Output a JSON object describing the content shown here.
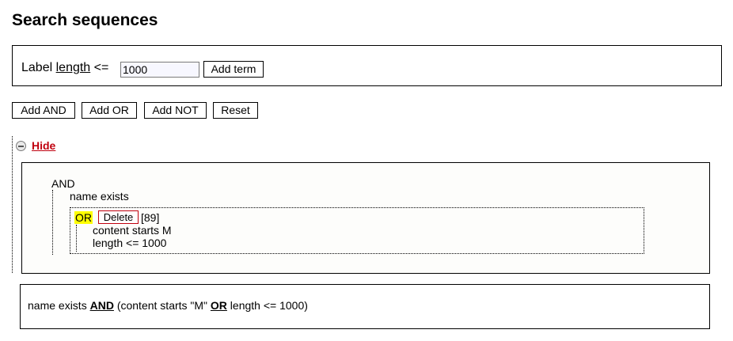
{
  "page": {
    "title": "Search sequences"
  },
  "term_builder": {
    "label_prefix": "Label",
    "field_name": "length",
    "operator": "<=",
    "value": "1000",
    "add_term_label": "Add term"
  },
  "toolbar": {
    "add_and_label": "Add AND",
    "add_or_label": "Add OR",
    "add_not_label": "Add NOT",
    "reset_label": "Reset"
  },
  "tree_toggle": {
    "icon": "minus-circle-icon",
    "label": "Hide",
    "color": "#c0000f"
  },
  "tree": {
    "root_operator": "AND",
    "root_children": [
      "name exists"
    ],
    "group": {
      "operator": "OR",
      "delete_label": "Delete",
      "count": "[89]",
      "highlight_color": "#ffff00",
      "children": [
        "content starts M",
        "length <= 1000"
      ]
    }
  },
  "summary": {
    "part1": "name exists ",
    "op1": "AND",
    "part2": " (content starts \"M\" ",
    "op2": "OR",
    "part3": " length <= 1000)"
  }
}
